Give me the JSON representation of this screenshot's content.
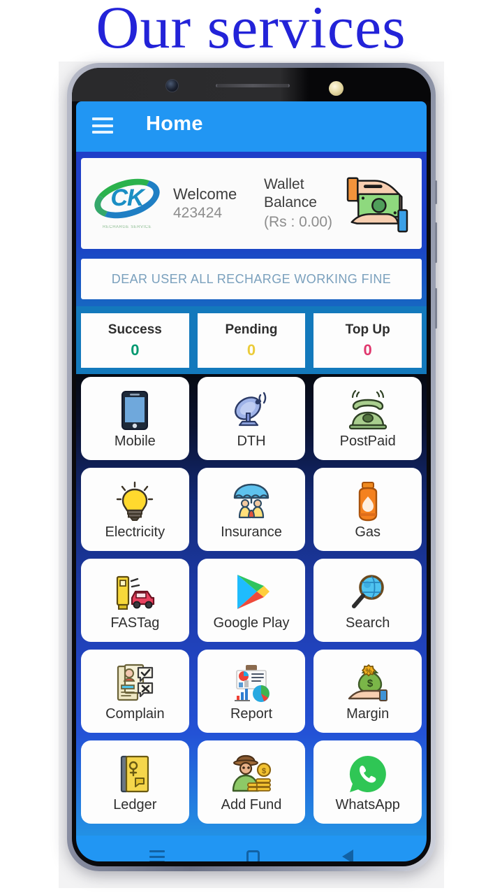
{
  "page": {
    "title": "Our services"
  },
  "appbar": {
    "title": "Home",
    "menu_icon": "hamburger-menu-icon"
  },
  "welcome": {
    "logo_text": "CK",
    "logo_subtext": "RECHARGE SERVICE",
    "welcome_label": "Welcome",
    "user_id": "423424",
    "wallet_label_line1": "Wallet",
    "wallet_label_line2": "Balance",
    "wallet_amount": "(Rs : 0.00)",
    "wallet_icon": "money-in-hand-icon"
  },
  "notice": {
    "text": "DEAR USER ALL RECHARGE WORKING FINE"
  },
  "stats": [
    {
      "label": "Success",
      "value": "0",
      "color": "#009970"
    },
    {
      "label": "Pending",
      "value": "0",
      "color": "#ebcc3b"
    },
    {
      "label": "Top Up",
      "value": "0",
      "color": "#e0376d"
    }
  ],
  "services": [
    [
      {
        "label": "Mobile",
        "icon": "mobile-phone-icon"
      },
      {
        "label": "DTH",
        "icon": "satellite-dish-icon"
      },
      {
        "label": "PostPaid",
        "icon": "telephone-icon"
      }
    ],
    [
      {
        "label": "Electricity",
        "icon": "light-bulb-icon"
      },
      {
        "label": "Insurance",
        "icon": "umbrella-family-icon"
      },
      {
        "label": "Gas",
        "icon": "gas-cylinder-icon"
      }
    ],
    [
      {
        "label": "FASTag",
        "icon": "toll-car-icon"
      },
      {
        "label": "Google Play",
        "icon": "google-play-icon"
      },
      {
        "label": "Search",
        "icon": "magnifier-globe-icon"
      }
    ],
    [
      {
        "label": "Complain",
        "icon": "complaint-document-icon"
      },
      {
        "label": "Report",
        "icon": "charts-report-icon"
      },
      {
        "label": "Margin",
        "icon": "money-bag-percent-icon"
      }
    ],
    [
      {
        "label": "Ledger",
        "icon": "ledger-book-icon"
      },
      {
        "label": "Add Fund",
        "icon": "person-coins-icon"
      },
      {
        "label": "WhatsApp",
        "icon": "whatsapp-icon"
      }
    ]
  ],
  "navbar": {
    "recents_icon": "recents-icon",
    "home_icon": "home-square-icon",
    "back_icon": "back-triangle-icon"
  },
  "colors": {
    "appbar_blue": "#2196f3",
    "title_blue": "#2323d8",
    "stats_band": "#1379bc",
    "upper_blue": "#1b3fc6"
  }
}
